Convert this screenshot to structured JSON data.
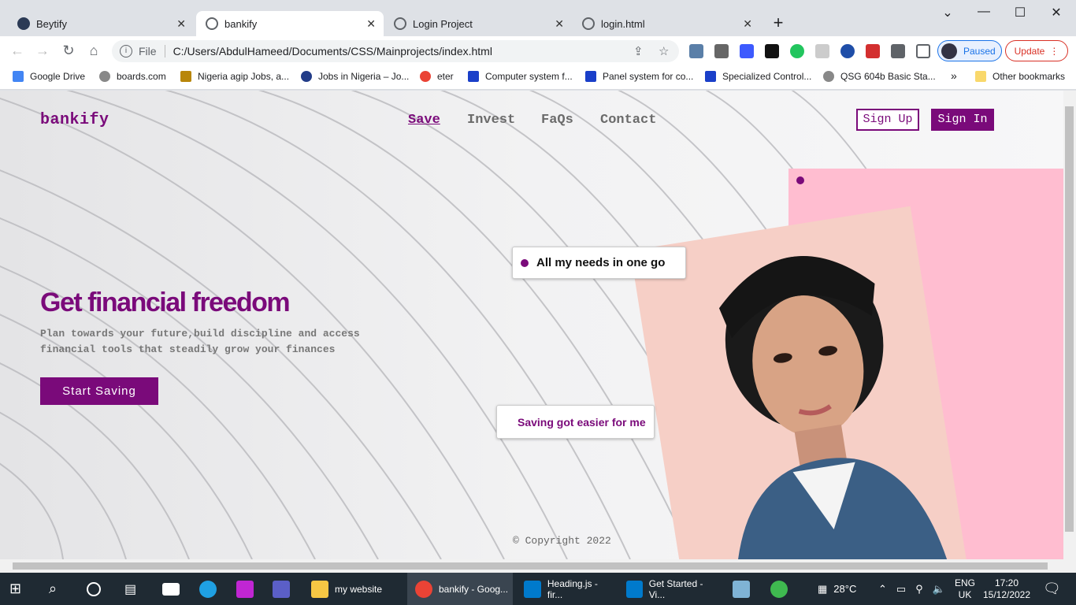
{
  "browser": {
    "tabs": [
      {
        "title": "Beytify",
        "active": false
      },
      {
        "title": "bankify",
        "active": true
      },
      {
        "title": "Login Project",
        "active": false
      },
      {
        "title": "login.html",
        "active": false
      }
    ],
    "new_tab": "+",
    "address": {
      "scheme_label": "File",
      "url": "C:/Users/AbdulHameed/Documents/CSS/Mainprojects/index.html"
    },
    "profile_status": "Paused",
    "update_label": "Update",
    "bookmarks": [
      "Google Drive",
      "boards.com",
      "Nigeria agip Jobs, a...",
      "Jobs in Nigeria – Jo...",
      "eter",
      "Computer system f...",
      "Panel system for co...",
      "Specialized Control...",
      "QSG 604b Basic Sta..."
    ],
    "bookmarks_overflow": "»",
    "other_bookmarks": "Other bookmarks"
  },
  "site": {
    "logo": "bankify",
    "nav": [
      "Save",
      "Invest",
      "FaQs",
      "Contact"
    ],
    "sign_up": "Sign Up",
    "sign_in": "Sign In",
    "hero_title": "Get financial freedom",
    "hero_subtitle": "Plan towards your future,build discipline and access financial tools that steadily grow your finances",
    "cta": "Start Saving",
    "card_top": "All my needs in one go",
    "card_bottom": "Saving got easier for me",
    "copyright": "© Copyright 2022",
    "colors": {
      "brand": "#7a0a7a",
      "pink": "#ffbdd0"
    }
  },
  "taskbar": {
    "apps": [
      {
        "label": "my website",
        "active": false
      },
      {
        "label": "bankify - Goog...",
        "active": true
      },
      {
        "label": "Heading.js - fir...",
        "active": false
      },
      {
        "label": "Get Started - Vi...",
        "active": false
      }
    ],
    "weather": "28°C",
    "lang": "ENG",
    "region": "UK",
    "time": "17:20",
    "date": "15/12/2022"
  }
}
